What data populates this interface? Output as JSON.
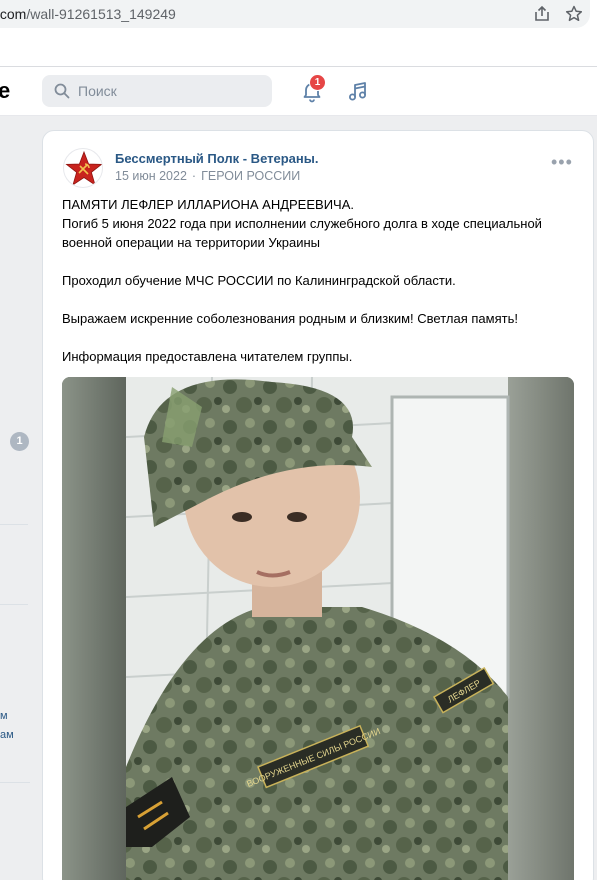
{
  "browser": {
    "url_host": "vk.com",
    "url_path": "/wall-91261513_149249"
  },
  "header": {
    "logo_fragment": "e",
    "search_placeholder": "Поиск",
    "notification_count": "1"
  },
  "sidebar": {
    "badge": "1",
    "fragment_1": "м",
    "fragment_2": "ам"
  },
  "post": {
    "author": "Бессмертный Полк - Ветераны.",
    "date": "15 июн 2022",
    "category": "ГЕРОИ РОССИИ",
    "lines": [
      "ПАМЯТИ ЛЕФЛЕР ИЛЛАРИОНА АНДРЕЕВИЧА.",
      "Погиб 5 июня 2022 года при исполнении служебного долга в ходе специальной",
      "военной операции на территории Украины",
      "Проходил обучение МЧС РОССИИ по Калининградской области.",
      "Выражаем искренние соболезнования родным и близким! Светлая память!",
      "Информация предоставлена читателем группы."
    ],
    "photo_patch_text": "ВООРУЖЕННЫЕ СИЛЫ РОССИИ",
    "photo_tag_text": "ЛЕФЛЕР"
  },
  "colors": {
    "link": "#2a5885",
    "badge_red": "#e64646",
    "meta_gray": "#818c99"
  }
}
